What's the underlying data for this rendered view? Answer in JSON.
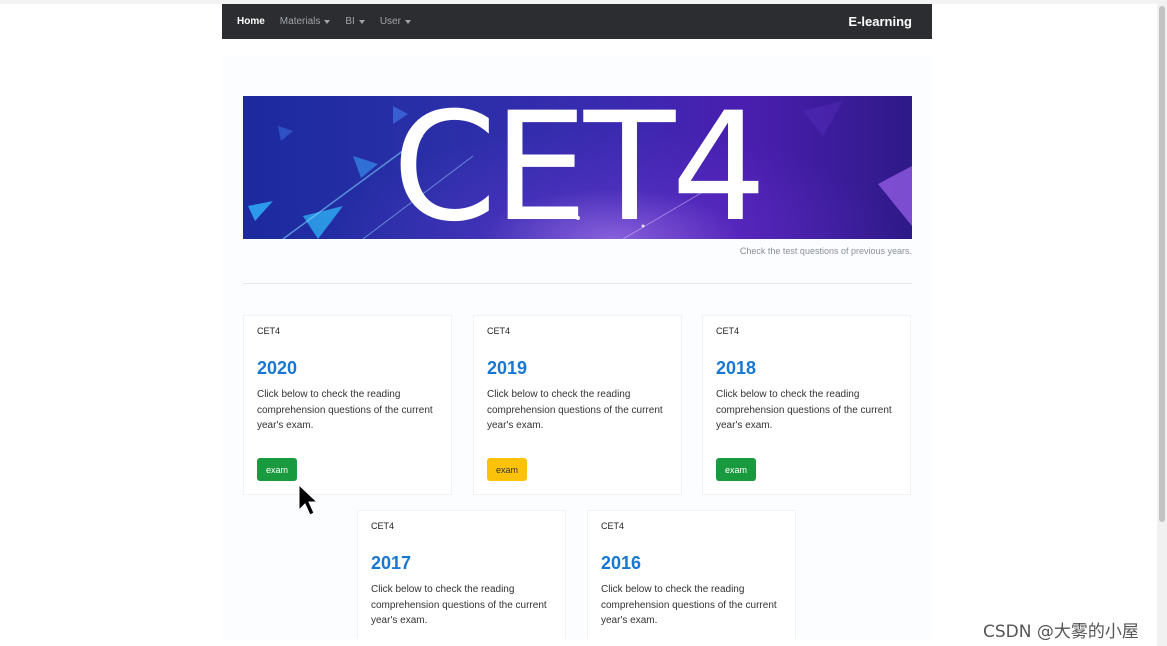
{
  "navbar": {
    "items": [
      {
        "label": "Home",
        "active": true,
        "dropdown": false
      },
      {
        "label": "Materials",
        "active": false,
        "dropdown": true
      },
      {
        "label": "BI",
        "active": false,
        "dropdown": true
      },
      {
        "label": "User",
        "active": false,
        "dropdown": true
      }
    ],
    "brand": "E-learning"
  },
  "banner": {
    "title": "CET4",
    "caption": "Check the test questions of previous years."
  },
  "cards": [
    {
      "category": "CET4",
      "year": "2020",
      "text": "Click below to check the reading comprehension questions of the current year's exam.",
      "button": "exam",
      "button_color": "#199a3e"
    },
    {
      "category": "CET4",
      "year": "2019",
      "text": "Click below to check the reading comprehension questions of the current year's exam.",
      "button": "exam",
      "button_color": "#fcc20a"
    },
    {
      "category": "CET4",
      "year": "2018",
      "text": "Click below to check the reading comprehension questions of the current year's exam.",
      "button": "exam",
      "button_color": "#199a3e"
    },
    {
      "category": "CET4",
      "year": "2017",
      "text": "Click below to check the reading comprehension questions of the current year's exam."
    },
    {
      "category": "CET4",
      "year": "2016",
      "text": "Click below to check the reading comprehension questions of the current year's exam."
    }
  ],
  "watermark": "CSDN @大雾的小屋",
  "colors": {
    "navbar_bg": "#2b2d31",
    "year_link": "#1877d2",
    "green": "#199a3e",
    "yellow": "#fcc20a"
  }
}
